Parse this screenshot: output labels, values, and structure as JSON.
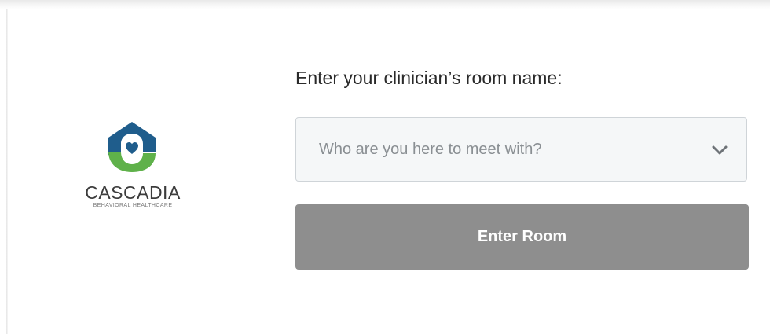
{
  "brand": {
    "name": "CASCADIA",
    "subtitle": "BEHAVIORAL HEALTHCARE",
    "logo_icon": "house-heart-logo-icon",
    "colors": {
      "roof_blue": "#1f5d8c",
      "base_green": "#5fb14a",
      "heart_blue": "#1f5d8c"
    }
  },
  "form": {
    "prompt": "Enter your clinician’s room name:",
    "room_select": {
      "placeholder": "Who are you here to meet with?",
      "icon": "chevron-down-icon"
    },
    "enter_button": {
      "label": "Enter Room",
      "color": "#8e8e8e"
    }
  }
}
